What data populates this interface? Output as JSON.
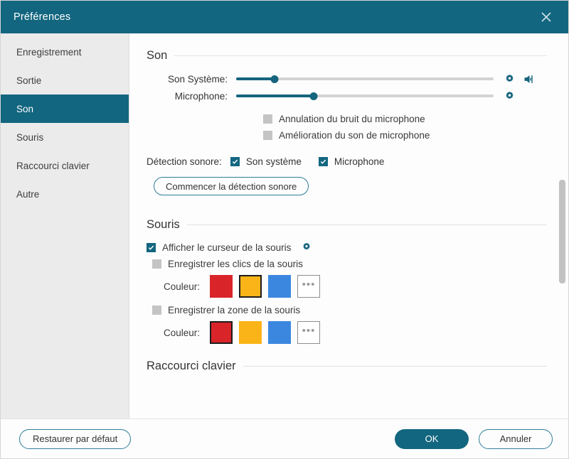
{
  "window": {
    "title": "Préférences",
    "close_icon": "close-icon",
    "accent_color": "#13667f"
  },
  "sidebar": {
    "items": [
      {
        "label": "Enregistrement",
        "active": false
      },
      {
        "label": "Sortie",
        "active": false
      },
      {
        "label": "Son",
        "active": true
      },
      {
        "label": "Souris",
        "active": false
      },
      {
        "label": "Raccourci clavier",
        "active": false
      },
      {
        "label": "Autre",
        "active": false
      }
    ]
  },
  "sound": {
    "heading": "Son",
    "system_volume": {
      "label": "Son Système:",
      "value_percent": 15,
      "gear_icon": "gear-icon",
      "speaker_icon": "speaker-icon"
    },
    "microphone_volume": {
      "label": "Microphone:",
      "value_percent": 30,
      "gear_icon": "gear-icon"
    },
    "checkboxes": [
      {
        "label": "Annulation du bruit du microphone",
        "state": "disabled"
      },
      {
        "label": "Amélioration du son de microphone",
        "state": "disabled"
      }
    ],
    "detection": {
      "label": "Détection sonore:",
      "options": [
        {
          "label": "Son système",
          "checked": true
        },
        {
          "label": "Microphone",
          "checked": true
        }
      ],
      "start_button": "Commencer la détection sonore"
    }
  },
  "mouse": {
    "heading": "Souris",
    "show_cursor": {
      "label": "Afficher le curseur de la souris",
      "checked": true,
      "gear_icon": "gear-icon"
    },
    "record_clicks": {
      "label": "Enregistrer les clics de la souris",
      "state": "disabled",
      "color_label": "Couleur:",
      "swatches": [
        {
          "name": "red",
          "hex": "#d9252a",
          "selected": false
        },
        {
          "name": "yellow",
          "hex": "#fbb418",
          "selected": true
        },
        {
          "name": "blue",
          "hex": "#3b87e0",
          "selected": false
        }
      ],
      "more_label": "•••"
    },
    "record_area": {
      "label": "Enregistrer la zone de la souris",
      "state": "disabled",
      "color_label": "Couleur:",
      "swatches": [
        {
          "name": "red",
          "hex": "#d9252a",
          "selected": true
        },
        {
          "name": "yellow",
          "hex": "#fbb418",
          "selected": false
        },
        {
          "name": "blue",
          "hex": "#3b87e0",
          "selected": false
        }
      ],
      "more_label": "•••"
    }
  },
  "shortcut": {
    "heading": "Raccourci clavier"
  },
  "scrollbar": {
    "thumb_top_percent": 38,
    "thumb_height_percent": 27
  },
  "footer": {
    "restore_label": "Restaurer par défaut",
    "ok_label": "OK",
    "cancel_label": "Annuler"
  }
}
